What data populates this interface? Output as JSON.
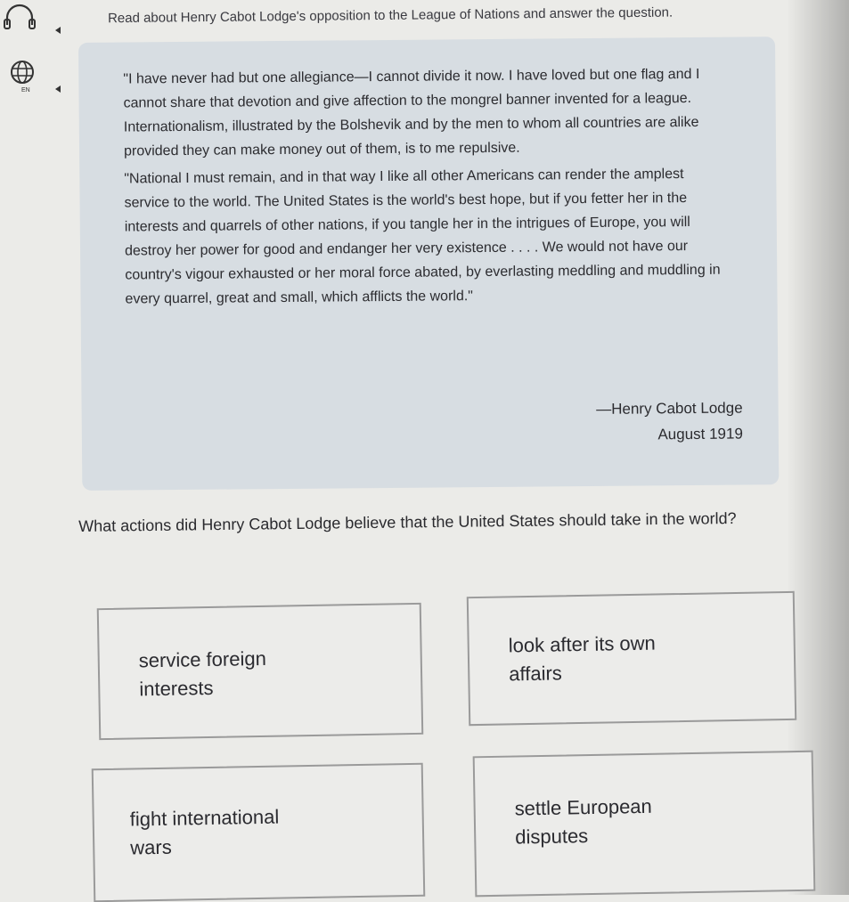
{
  "toolbar": {
    "headphones_icon": "headphones-icon",
    "language_icon": "globe-icon",
    "language_code": "EN"
  },
  "instructions": {
    "text": "Read about Henry Cabot Lodge's opposition to the League of Nations and answer the question."
  },
  "passage": {
    "paragraph_1": "\"I have never had but one allegiance—I cannot divide it now. I have loved but one flag and I cannot share that devotion and give affection to the mongrel banner invented for a league. Internationalism, illustrated by the Bolshevik and by the men to whom all countries are alike provided they can make money out of them, is to me repulsive.",
    "paragraph_2": "\"National I must remain, and in that way I like all other Americans can render the amplest service to the world. The United States is the world's best hope, but if you fetter her in the interests and quarrels of other nations, if you tangle her in the intrigues of Europe, you will destroy her power for good and endanger her very existence . . . . We would not have our country's vigour exhausted or her moral force abated, by everlasting meddling and muddling in every quarrel, great and small, which afflicts the world.\"",
    "author": "—Henry Cabot Lodge",
    "date": "August 1919"
  },
  "question": {
    "text": "What actions did Henry Cabot Lodge believe that the United States should take in the world?"
  },
  "choices": [
    {
      "label": "service foreign interests"
    },
    {
      "label": "look after its own affairs"
    },
    {
      "label": "fight international wars"
    },
    {
      "label": "settle European disputes"
    }
  ]
}
